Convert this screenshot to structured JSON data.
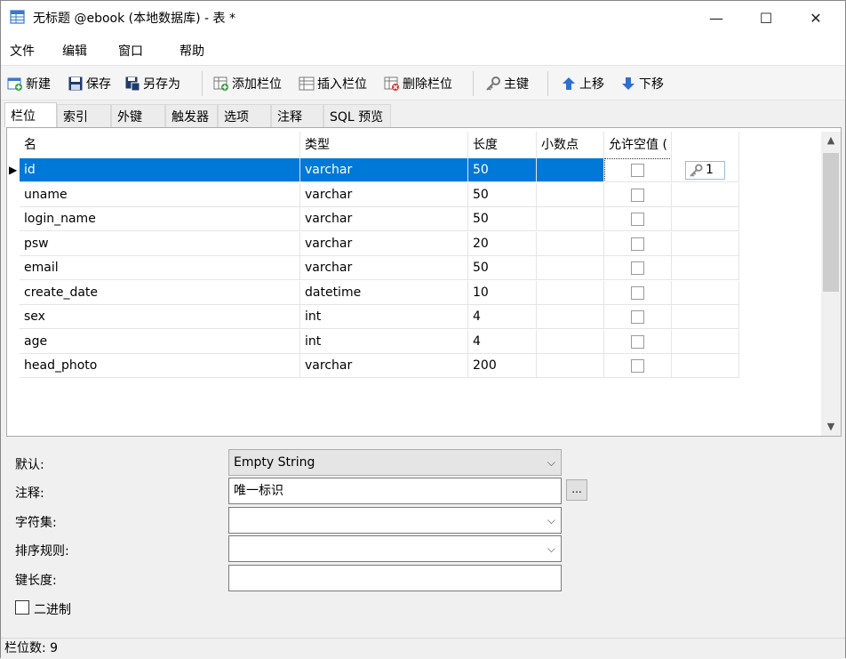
{
  "window": {
    "title": "无标题 @ebook (本地数据库) - 表 *",
    "minimize_glyph": "—",
    "maximize_glyph": "☐",
    "close_glyph": "✕"
  },
  "menu": [
    "文件",
    "编辑",
    "窗口",
    "帮助"
  ],
  "toolbar": {
    "new": "新建",
    "save": "保存",
    "save_as": "另存为",
    "add_column": "添加栏位",
    "insert_column": "插入栏位",
    "delete_column": "删除栏位",
    "primary_key": "主键",
    "move_up": "上移",
    "move_down": "下移"
  },
  "tabs": [
    "栏位",
    "索引",
    "外键",
    "触发器",
    "选项",
    "注释",
    "SQL 预览"
  ],
  "active_tab": "栏位",
  "grid": {
    "headers": [
      "名",
      "类型",
      "长度",
      "小数点",
      "允许空值 (",
      ""
    ],
    "rows": [
      {
        "name": "id",
        "type": "varchar",
        "length": "50",
        "decimals": "",
        "nullable": false,
        "key": "1"
      },
      {
        "name": "uname",
        "type": "varchar",
        "length": "50",
        "decimals": "",
        "nullable": false,
        "key": ""
      },
      {
        "name": "login_name",
        "type": "varchar",
        "length": "50",
        "decimals": "",
        "nullable": false,
        "key": ""
      },
      {
        "name": "psw",
        "type": "varchar",
        "length": "20",
        "decimals": "",
        "nullable": false,
        "key": ""
      },
      {
        "name": "email",
        "type": "varchar",
        "length": "50",
        "decimals": "",
        "nullable": false,
        "key": ""
      },
      {
        "name": "create_date",
        "type": "datetime",
        "length": "10",
        "decimals": "",
        "nullable": false,
        "key": ""
      },
      {
        "name": "sex",
        "type": "int",
        "length": "4",
        "decimals": "",
        "nullable": false,
        "key": ""
      },
      {
        "name": "age",
        "type": "int",
        "length": "4",
        "decimals": "",
        "nullable": false,
        "key": ""
      },
      {
        "name": "head_photo",
        "type": "varchar",
        "length": "200",
        "decimals": "",
        "nullable": false,
        "key": ""
      }
    ],
    "selected_row": 0,
    "row_marker": "▶"
  },
  "properties": {
    "default_label": "默认:",
    "default_value": "Empty String",
    "comment_label": "注释:",
    "comment_value": "唯一标识",
    "charset_label": "字符集:",
    "charset_value": "",
    "collation_label": "排序规则:",
    "collation_value": "",
    "key_length_label": "键长度:",
    "key_length_value": "",
    "binary_label": "二进制",
    "binary_checked": false,
    "ellipsis": "..."
  },
  "status": {
    "text": "栏位数: 9"
  }
}
